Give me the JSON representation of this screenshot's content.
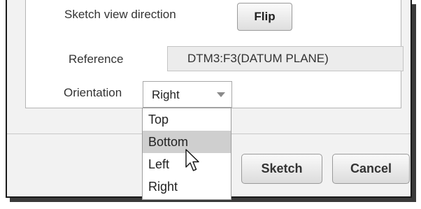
{
  "dialog": {
    "sketch_view_direction_label": "Sketch view direction",
    "flip_button": "Flip",
    "reference_label": "Reference",
    "reference_value": "DTM3:F3(DATUM PLANE)",
    "orientation_label": "Orientation",
    "orientation_selected": "Right",
    "orientation_options": [
      "Top",
      "Bottom",
      "Left",
      "Right"
    ],
    "hovered_option": "Bottom",
    "sketch_button": "Sketch",
    "cancel_button": "Cancel"
  }
}
